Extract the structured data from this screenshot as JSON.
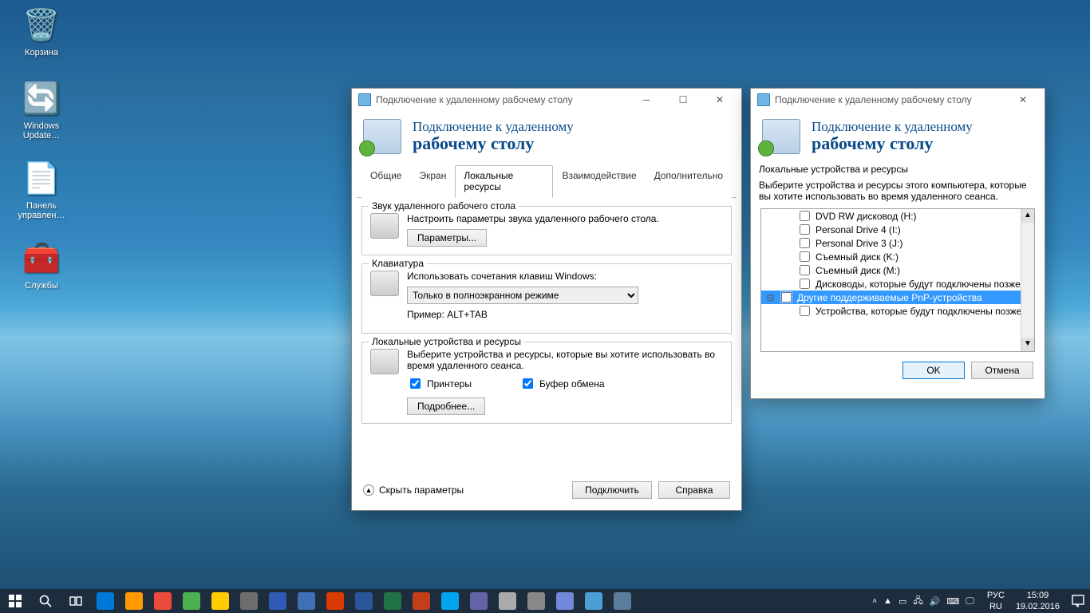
{
  "desktop_icons": [
    {
      "label": "Корзина"
    },
    {
      "label": "Windows Update…"
    },
    {
      "label": "Панель управлен…"
    },
    {
      "label": "Службы"
    }
  ],
  "win1": {
    "title": "Подключение к удаленному рабочему столу",
    "banner_l1": "Подключение к удаленному",
    "banner_l2": "рабочему столу",
    "tabs": [
      "Общие",
      "Экран",
      "Локальные ресурсы",
      "Взаимодействие",
      "Дополнительно"
    ],
    "active_tab": 2,
    "group_audio": {
      "legend": "Звук удаленного рабочего стола",
      "desc": "Настроить параметры звука удаленного рабочего стола.",
      "btn": "Параметры..."
    },
    "group_kb": {
      "legend": "Клавиатура",
      "desc": "Использовать сочетания клавиш Windows:",
      "select": "Только в полноэкранном режиме",
      "example": "Пример: ALT+TAB"
    },
    "group_dev": {
      "legend": "Локальные устройства и ресурсы",
      "desc": "Выберите устройства и ресурсы, которые вы хотите использовать во время удаленного сеанса.",
      "cb1": "Принтеры",
      "cb2": "Буфер обмена",
      "btn": "Подробнее..."
    },
    "footer": {
      "collapse": "Скрыть параметры",
      "connect": "Подключить",
      "help": "Справка"
    }
  },
  "win2": {
    "title": "Подключение к удаленному рабочему столу",
    "banner_l1": "Подключение к удаленному",
    "banner_l2": "рабочему столу",
    "section": "Локальные устройства и ресурсы",
    "desc": "Выберите устройства и ресурсы этого компьютера, которые вы хотите использовать во время удаленного сеанса.",
    "items": [
      "DVD RW дисковод (H:)",
      "Personal Drive 4 (I:)",
      "Personal Drive 3 (J:)",
      "Съемный диск (K:)",
      "Съемный диск (M:)",
      "Дисководы, которые будут подключены позже"
    ],
    "sel_item": "Другие поддерживаемые PnP-устройства",
    "sub_item": "Устройства, которые будут подключены позже",
    "ok": "OK",
    "cancel": "Отмена"
  },
  "taskbar": {
    "lang1": "РУС",
    "lang2": "RU",
    "time": "15:09",
    "date": "19.02.2016"
  },
  "taskbar_apps_colors": [
    "#0078d7",
    "#ff9a00",
    "#ec4b3b",
    "#4caf50",
    "#ffcc00",
    "#6d6d6d",
    "#2f5bb7",
    "#3f6fb5",
    "#d83b01",
    "#2a5699",
    "#217346",
    "#c43e1c",
    "#00a4ef",
    "#6264a7",
    "#aaaaaa",
    "#888888",
    "#7289da",
    "#4b9ed6",
    "#5c7c9c"
  ]
}
